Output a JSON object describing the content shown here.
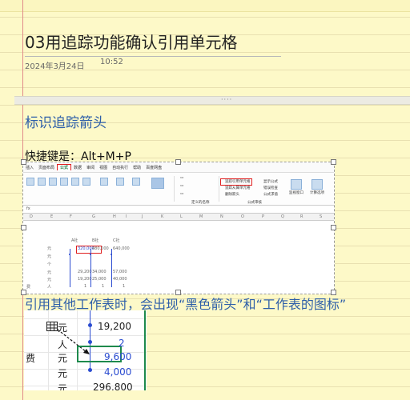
{
  "page": {
    "title": "03用追踪功能确认引用单元格",
    "date": "2024年3月24日",
    "time": "10:52"
  },
  "section1": {
    "heading": "标识追踪箭头",
    "shortcut": "快捷键是：Alt+M+P"
  },
  "excel_ribbon": {
    "tabs": [
      "插入",
      "页面布局",
      "公式",
      "数据",
      "审阅",
      "视图",
      "自动执行",
      "帮助",
      "百度网盘"
    ],
    "active_tab": "公式",
    "group_labels": [
      "定义的名称",
      "公式审核"
    ],
    "buttons": [
      "追踪引用单元格",
      "追踪从属单元格",
      "删除箭头",
      "显示公式",
      "错误检查",
      "公式求值",
      "监视窗口",
      "计算选项"
    ],
    "formula_bar_label": "fx",
    "columns": [
      "D",
      "E",
      "F",
      "G",
      "H",
      "I",
      "J",
      "K",
      "L",
      "M",
      "N",
      "O",
      "P",
      "Q",
      "R",
      "S"
    ],
    "column_headers": [
      "A社",
      "B社",
      "C社"
    ],
    "rows": [
      {
        "unit": "元",
        "a": "320,000",
        "b": "480,000",
        "c": "640,000"
      },
      {
        "unit": "元",
        "a": "",
        "b": "",
        "c": ""
      },
      {
        "unit": "个",
        "a": "",
        "b": "",
        "c": ""
      },
      {
        "unit": "元",
        "a": "29,200",
        "b": "34,000",
        "c": "57,000"
      },
      {
        "unit": "元",
        "a": "19,200",
        "b": "25,000",
        "c": "40,000"
      },
      {
        "unit": "人",
        "a": "1",
        "b": "1",
        "c": "1"
      }
    ],
    "side_label": "费"
  },
  "section2": {
    "heading": "引用其他工作表时，会出现“黑色箭头”和“工作表的图标”"
  },
  "zoom_table": {
    "rows": [
      {
        "label": "",
        "unit": "元",
        "value": "19,200"
      },
      {
        "label": "",
        "unit": "人",
        "value": "2"
      },
      {
        "label": "费",
        "unit": "元",
        "value": "9,600"
      },
      {
        "label": "",
        "unit": "元",
        "value": "4,000"
      },
      {
        "label": "",
        "unit": "元",
        "value": "296,800"
      }
    ]
  },
  "colors": {
    "heading": "#2e5fa9",
    "highlight": "#e01f1f",
    "trace_arrow": "#2a4bd0",
    "selected_cell": "#1e8a4c"
  }
}
